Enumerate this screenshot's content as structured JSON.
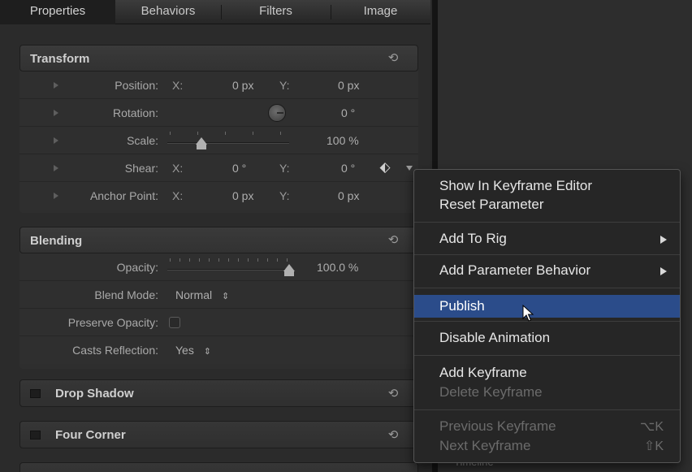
{
  "tabs": [
    "Properties",
    "Behaviors",
    "Filters",
    "Image"
  ],
  "transform": {
    "title": "Transform",
    "position": {
      "label": "Position:",
      "x_label": "X:",
      "x_value": "0 px",
      "y_label": "Y:",
      "y_value": "0 px"
    },
    "rotation": {
      "label": "Rotation:",
      "value": "0 °"
    },
    "scale": {
      "label": "Scale:",
      "value": "100 %",
      "slider_fraction": 0.28
    },
    "shear": {
      "label": "Shear:",
      "x_label": "X:",
      "x_value": "0 °",
      "y_label": "Y:",
      "y_value": "0 °"
    },
    "anchor": {
      "label": "Anchor Point:",
      "x_label": "X:",
      "x_value": "0 px",
      "y_label": "Y:",
      "y_value": "0 px"
    }
  },
  "blending": {
    "title": "Blending",
    "opacity": {
      "label": "Opacity:",
      "value": "100.0 %",
      "slider_fraction": 1.0
    },
    "blend_mode": {
      "label": "Blend Mode:",
      "value": "Normal"
    },
    "preserve_opacity": {
      "label": "Preserve Opacity:",
      "checked": false
    },
    "casts_reflection": {
      "label": "Casts Reflection:",
      "value": "Yes"
    }
  },
  "collapsed_sections": [
    "Drop Shadow",
    "Four Corner"
  ],
  "viewer": {
    "timeline_label": "Timeline"
  },
  "context_menu": {
    "items": {
      "show_in_keyframe_editor": "Show In Keyframe Editor",
      "reset_parameter": "Reset Parameter",
      "add_to_rig": "Add To Rig",
      "add_parameter_behavior": "Add Parameter Behavior",
      "publish": "Publish",
      "disable_animation": "Disable Animation",
      "add_keyframe": "Add Keyframe",
      "delete_keyframe": "Delete Keyframe",
      "previous_keyframe": "Previous Keyframe",
      "previous_keyframe_shortcut": "⌥K",
      "next_keyframe": "Next Keyframe",
      "next_keyframe_shortcut": "⇧K"
    },
    "highlighted": "Publish"
  },
  "colors": {
    "highlight": "#2b4c8a",
    "panel": "#2b2b2b",
    "menu_bg": "#262626"
  }
}
